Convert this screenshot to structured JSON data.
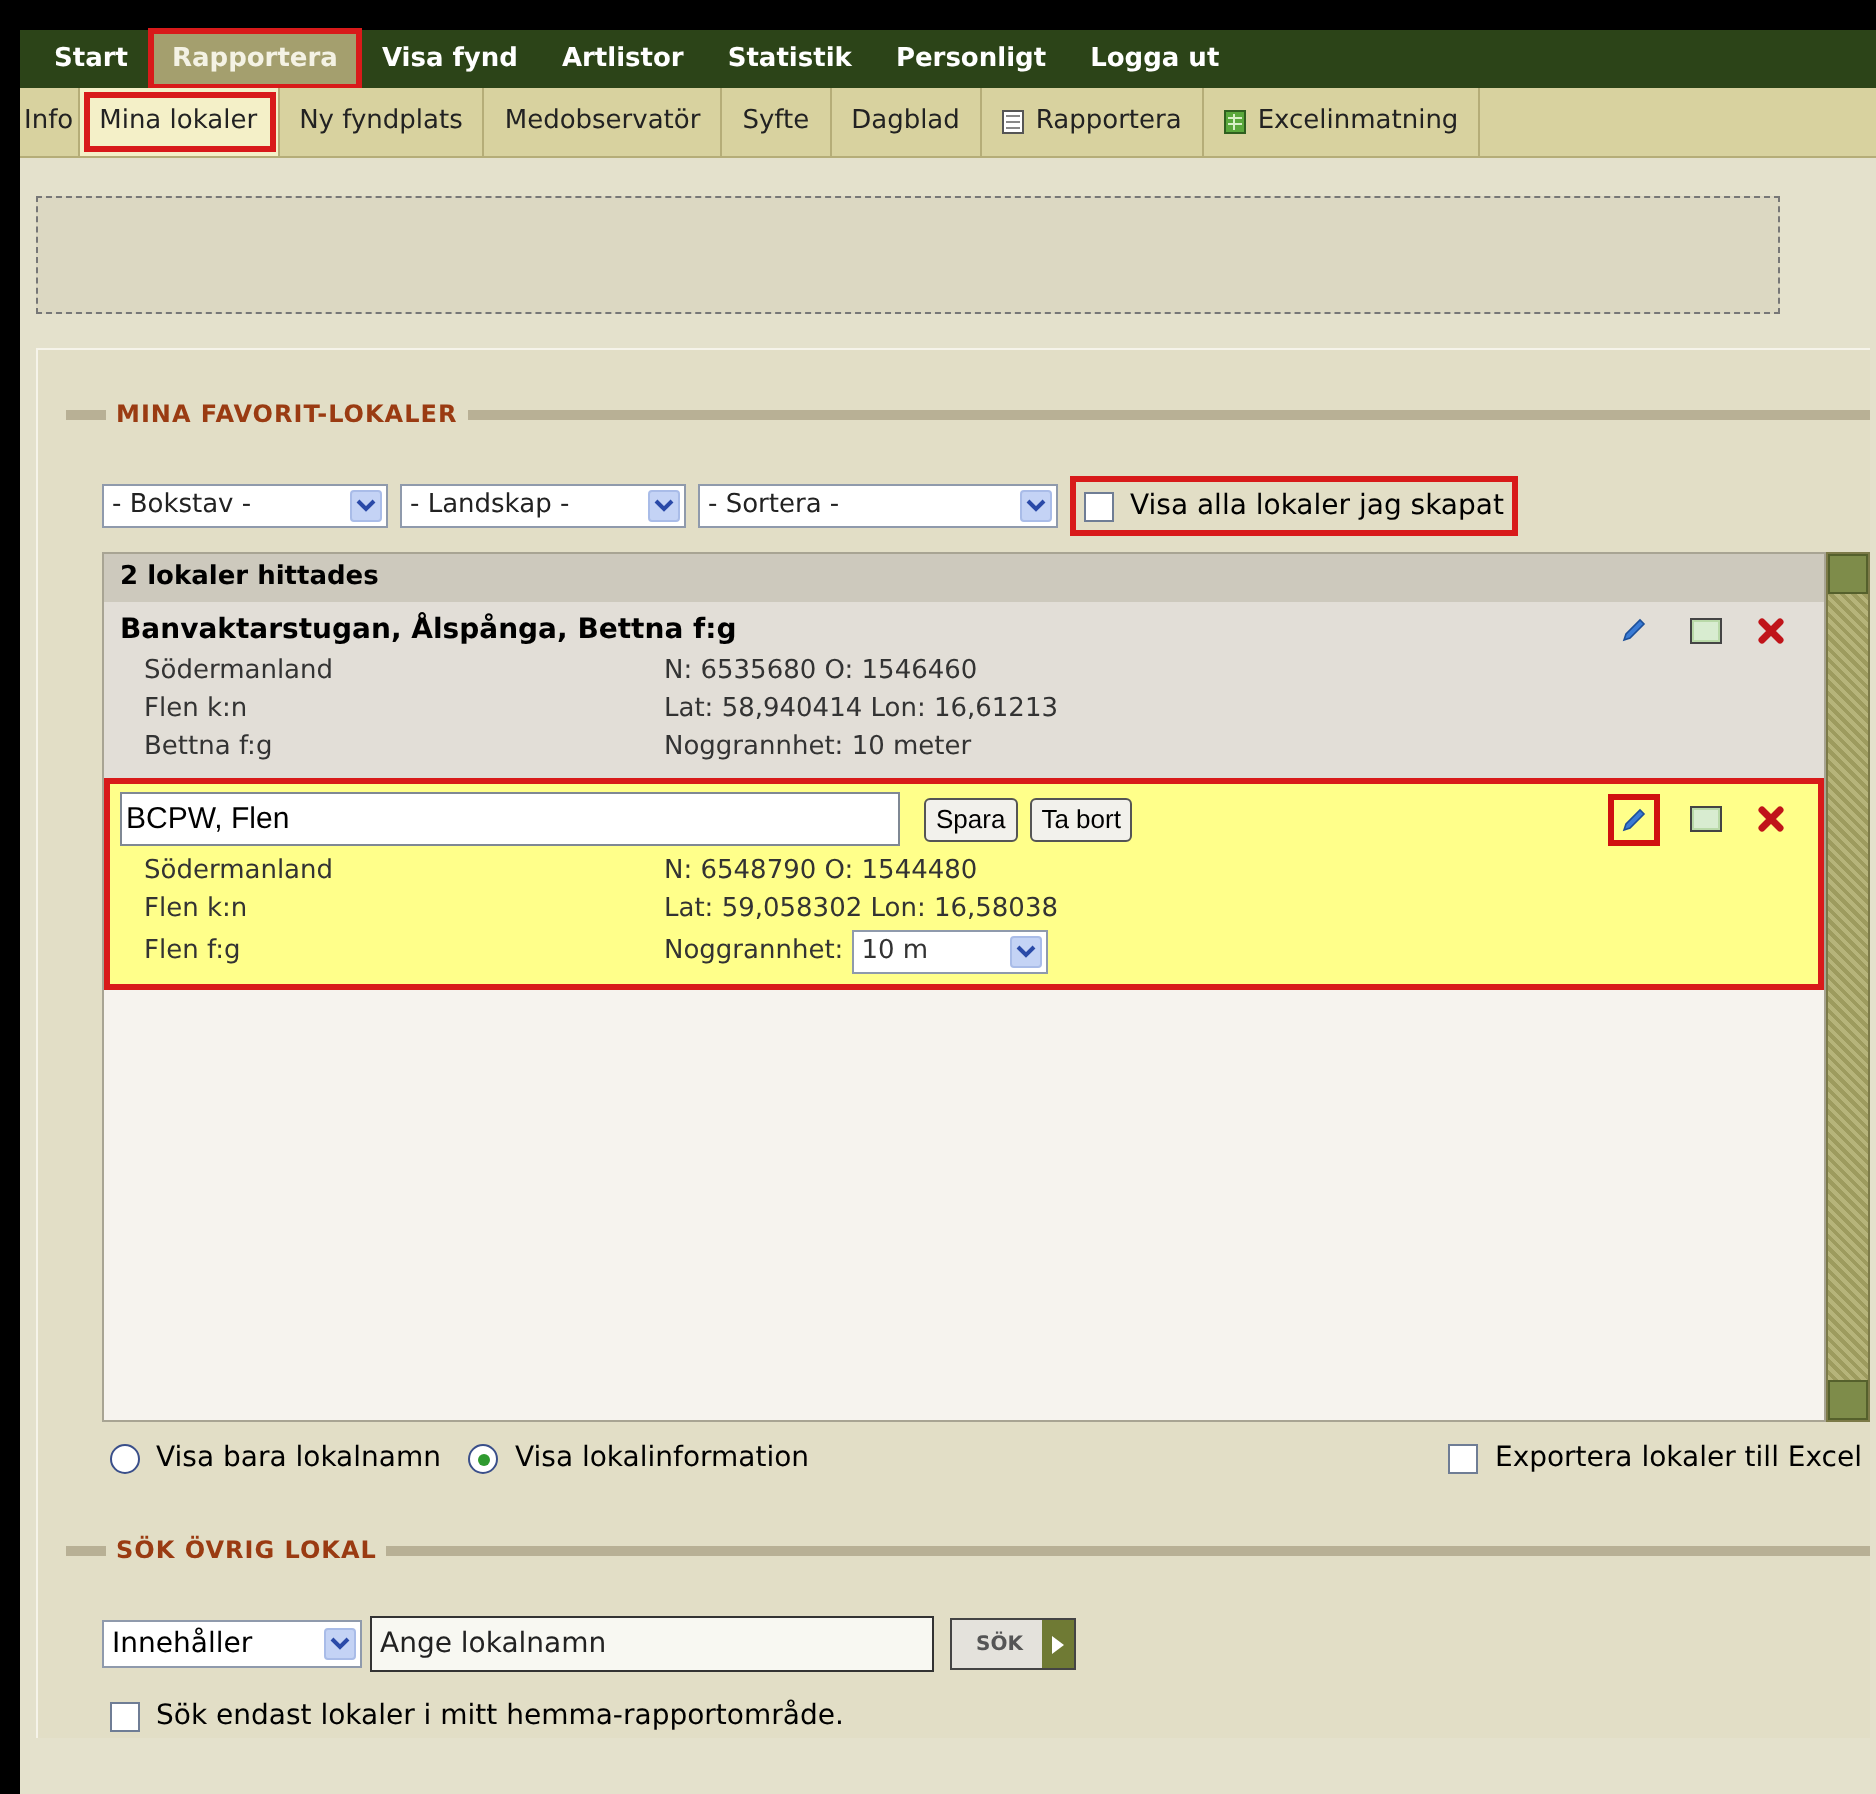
{
  "main_nav": [
    {
      "label": "Start",
      "selected": false,
      "annotated": false
    },
    {
      "label": "Rapportera",
      "selected": true,
      "annotated": true
    },
    {
      "label": "Visa fynd",
      "selected": false,
      "annotated": false
    },
    {
      "label": "Artlistor",
      "selected": false,
      "annotated": false
    },
    {
      "label": "Statistik",
      "selected": false,
      "annotated": false
    },
    {
      "label": "Personligt",
      "selected": false,
      "annotated": false
    },
    {
      "label": "Logga ut",
      "selected": false,
      "annotated": false
    }
  ],
  "sub_nav": [
    {
      "label": "Info",
      "selected": false,
      "annotated": false,
      "kind": "plain"
    },
    {
      "label": "Mina lokaler",
      "selected": true,
      "annotated": true,
      "kind": "plain"
    },
    {
      "label": "Ny fyndplats",
      "selected": false,
      "annotated": false,
      "kind": "plain"
    },
    {
      "label": "Medobservatör",
      "selected": false,
      "annotated": false,
      "kind": "plain"
    },
    {
      "label": "Syfte",
      "selected": false,
      "annotated": false,
      "kind": "plain"
    },
    {
      "label": "Dagblad",
      "selected": false,
      "annotated": false,
      "kind": "plain"
    },
    {
      "label": "Rapportera",
      "selected": false,
      "annotated": false,
      "kind": "page"
    },
    {
      "label": "Excelinmatning",
      "selected": false,
      "annotated": false,
      "kind": "sheet"
    }
  ],
  "favorites": {
    "title": "MINA FAVORIT-LOKALER",
    "filters": [
      {
        "value": "- Bokstav -"
      },
      {
        "value": "- Landskap -"
      },
      {
        "value": "- Sortera -"
      }
    ],
    "show_all": {
      "label": "Visa alla lokaler jag skapat",
      "checked": false,
      "annotated": true
    },
    "list": {
      "header": "2 lokaler hittades",
      "items": [
        {
          "kind": "view",
          "name": "Banvaktarstugan, Ålspånga, Bettna f:g",
          "annotated": false,
          "edit_annotated": false,
          "left": [
            "Södermanland",
            "Flen k:n",
            "Bettna f:g"
          ],
          "right": [
            "N: 6535680 O: 1546460",
            "Lat: 58,940414 Lon: 16,61213",
            "Noggrannhet: 10 meter"
          ]
        },
        {
          "kind": "edit",
          "name": "BCPW, Flen",
          "annotated": true,
          "edit_annotated": true,
          "buttons": [
            "Spara",
            "Ta bort"
          ],
          "left": [
            "Södermanland",
            "Flen k:n",
            "Flen f:g"
          ],
          "right": [
            "N: 6548790 O: 1544480",
            "Lat: 59,058302 Lon: 16,58038"
          ],
          "accuracy_label": "Noggrannhet:",
          "accuracy_value": "10 m"
        }
      ]
    },
    "view_options": [
      {
        "label": "Visa bara lokalnamn",
        "selected": false
      },
      {
        "label": "Visa lokalinformation",
        "selected": true
      }
    ],
    "export": {
      "label": "Exportera lokaler till Excel",
      "checked": false
    }
  },
  "search": {
    "title": "SÖK ÖVRIG LOKAL",
    "mode": "Innehåller",
    "placeholder": "Ange lokalnamn",
    "button": "SÖK",
    "home_only": {
      "label": "Sök endast lokaler i mitt hemma-rapportområde.",
      "checked": false
    }
  }
}
